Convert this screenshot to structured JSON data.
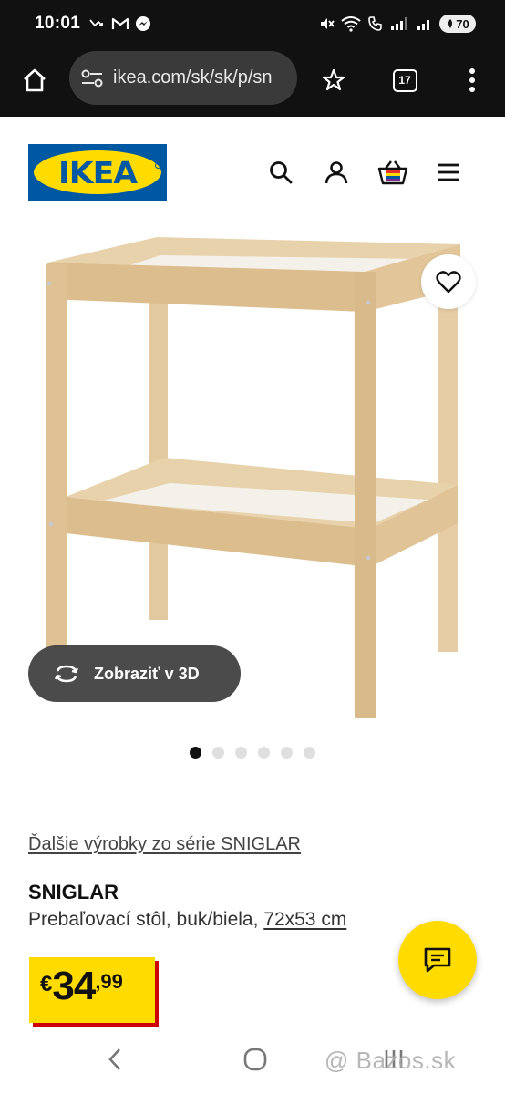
{
  "status_bar": {
    "time": "10:01",
    "battery": "70"
  },
  "browser": {
    "url": "ikea.com/sk/sk/p/sn",
    "tab_count": "17"
  },
  "header": {
    "logo_text": "IKEA"
  },
  "product": {
    "view_3d_label": "Zobraziť v 3D",
    "series_link": "Ďalšie výrobky zo série SNIGLAR",
    "name": "SNIGLAR",
    "description": "Prebaľovací stôl, buk/biela, ",
    "dimensions": "72x53 cm",
    "price": {
      "currency": "€",
      "integer": "34",
      "decimal": ",99"
    },
    "carousel": {
      "total": 6,
      "active": 1
    }
  },
  "watermark": "@ Bazos.sk",
  "icons": {
    "status": [
      "missed-call-icon",
      "gmail-icon",
      "messenger-icon",
      "mute-icon",
      "wifi-icon",
      "call-icon",
      "signal-icon",
      "battery-icon"
    ],
    "browser": [
      "home-icon",
      "site-settings-icon",
      "bookmark-star-icon",
      "tabs-icon",
      "more-menu-icon"
    ],
    "header": [
      "search-icon",
      "account-icon",
      "cart-icon",
      "hamburger-menu-icon"
    ],
    "product": [
      "heart-icon",
      "rotate-3d-icon",
      "chat-icon"
    ],
    "nav": [
      "back-icon",
      "home-circle-icon",
      "recents-icon"
    ]
  },
  "colors": {
    "ikea_blue": "#0058a3",
    "ikea_yellow": "#ffdb00",
    "price_shadow_red": "#cc0008",
    "status_bar_bg": "#111111"
  }
}
